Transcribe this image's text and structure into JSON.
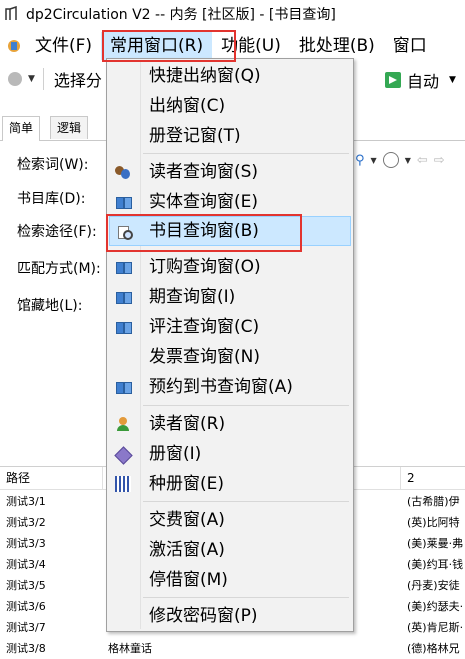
{
  "window": {
    "title": "dp2Circulation V2 -- 内务 [社区版] - [书目查询]"
  },
  "menubar": {
    "items": [
      "文件(F)",
      "常用窗口(R)",
      "功能(U)",
      "批处理(B)",
      "窗口"
    ]
  },
  "toolbar": {
    "label": "选择分",
    "auto_label": "自动"
  },
  "tabs": [
    "简单",
    "逻辑"
  ],
  "form": {
    "keyword_label": "检索词(W):",
    "db_label": "书目库(D):",
    "route_label": "检索途径(F):",
    "match_label": "匹配方式(M):",
    "location_label": "馆藏地(L):"
  },
  "results": {
    "headers": [
      "路径",
      "",
      "2"
    ],
    "rows": [
      {
        "path": "测试3/1",
        "title": "",
        "col2": "(古希腊)伊"
      },
      {
        "path": "测试3/2",
        "title": "",
        "col2": "(英)比阿特"
      },
      {
        "path": "测试3/3",
        "title": "",
        "col2": "(美)莱曼·弗"
      },
      {
        "path": "测试3/4",
        "title": "",
        "col2": "(美)约耳·钱"
      },
      {
        "path": "测试3/5",
        "title": "",
        "col2": "(丹麦)安徒"
      },
      {
        "path": "测试3/6",
        "title": "",
        "col2": "(美)约瑟夫·"
      },
      {
        "path": "测试3/7",
        "title": "",
        "col2": "(英)肯尼斯·"
      },
      {
        "path": "测试3/8",
        "title": "格林童话",
        "col2": "(德)格林兄"
      }
    ]
  },
  "dropdown": {
    "items": [
      {
        "label": "快捷出纳窗(Q)",
        "icon": ""
      },
      {
        "label": "出纳窗(C)",
        "icon": ""
      },
      {
        "label": "册登记窗(T)",
        "icon": ""
      },
      {
        "label": "读者查询窗(S)",
        "icon": "people-icon"
      },
      {
        "label": "实体查询窗(E)",
        "icon": "book-icon"
      },
      {
        "label": "书目查询窗(B)",
        "icon": "search-doc-icon",
        "selected": true
      },
      {
        "label": "订购查询窗(O)",
        "icon": "book-icon"
      },
      {
        "label": "期查询窗(I)",
        "icon": "book-icon"
      },
      {
        "label": "评注查询窗(C)",
        "icon": "book-icon"
      },
      {
        "label": "发票查询窗(N)",
        "icon": ""
      },
      {
        "label": "预约到书查询窗(A)",
        "icon": "book-icon"
      },
      {
        "label": "读者窗(R)",
        "icon": "user-icon"
      },
      {
        "label": "册窗(I)",
        "icon": "gem-icon"
      },
      {
        "label": "种册窗(E)",
        "icon": "barcode-icon"
      },
      {
        "label": "交费窗(A)",
        "icon": ""
      },
      {
        "label": "激活窗(A)",
        "icon": ""
      },
      {
        "label": "停借窗(M)",
        "icon": ""
      },
      {
        "label": "修改密码窗(P)",
        "icon": ""
      }
    ]
  },
  "colors": {
    "highlight": "#cce8ff",
    "annotation_red": "#e2342f"
  }
}
